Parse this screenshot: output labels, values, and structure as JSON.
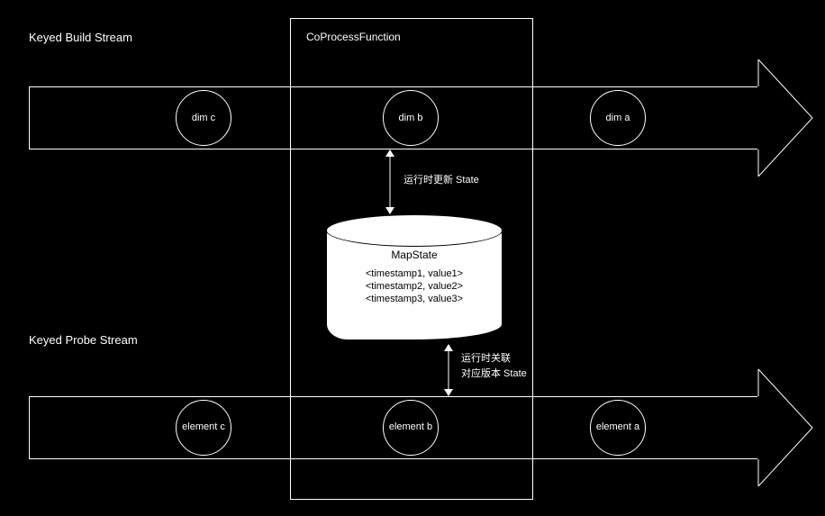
{
  "title_top": "Keyed Build Stream",
  "title_bottom": "Keyed Probe Stream",
  "fn_label": "CoProcessFunction",
  "top_circles": [
    "dim c",
    "dim b",
    "dim a"
  ],
  "bottom_circles": [
    "element c",
    "element b",
    "element a"
  ],
  "mapstate": {
    "title": "MapState",
    "rows": [
      "<timestamp1, value1>",
      "<timestamp2, value2>",
      "<timestamp3, value3>"
    ]
  },
  "anno_top": "运行时更新 State",
  "anno_bottom_l1": "运行时关联",
  "anno_bottom_l2": "对应版本 State"
}
